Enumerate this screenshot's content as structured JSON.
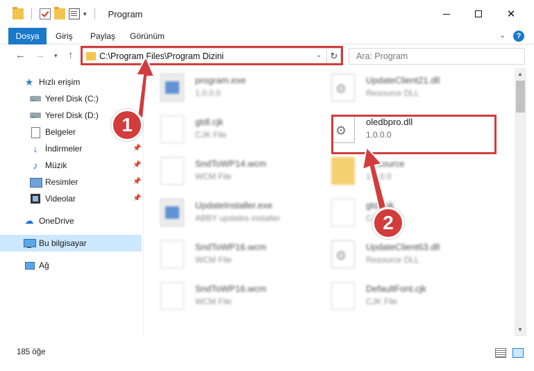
{
  "window": {
    "title": "Program",
    "minimize": "",
    "maximize": "",
    "close": "✕"
  },
  "ribbon": {
    "tabs": [
      "Dosya",
      "Giriş",
      "Paylaş",
      "Görünüm"
    ],
    "help": "?"
  },
  "nav": {
    "back": "←",
    "forward": "→",
    "recent": "▾",
    "up": "↑"
  },
  "address": {
    "path": "C:\\Program Files\\Program Dizini",
    "refresh": "↻"
  },
  "search": {
    "placeholder": "Ara: Program"
  },
  "sidebar": {
    "items": [
      {
        "label": "Hızlı erişim",
        "icon": "star-icon"
      },
      {
        "label": "Yerel Disk (C:)",
        "icon": "disk-icon"
      },
      {
        "label": "Yerel Disk (D:)",
        "icon": "disk-icon"
      },
      {
        "label": "Belgeler",
        "icon": "documents-icon"
      },
      {
        "label": "İndirmeler",
        "icon": "downloads-icon"
      },
      {
        "label": "Müzik",
        "icon": "music-icon"
      },
      {
        "label": "Resimler",
        "icon": "pictures-icon"
      },
      {
        "label": "Videolar",
        "icon": "videos-icon"
      },
      {
        "label": "OneDrive",
        "icon": "cloud-icon"
      },
      {
        "label": "Bu bilgisayar",
        "icon": "computer-icon"
      },
      {
        "label": "Ağ",
        "icon": "network-icon"
      }
    ]
  },
  "files": [
    {
      "name": "program.exe",
      "meta": "1.0.0.0",
      "icon": "exe-icon"
    },
    {
      "name": "UpdateClient21.dll",
      "meta": "Resource DLL",
      "icon": "dll-icon"
    },
    {
      "name": "gtdl.cjk",
      "meta": "CJK File",
      "icon": "file-icon"
    },
    {
      "name": "oledbpro.dll",
      "meta": "1.0.0.0",
      "icon": "dll-icon"
    },
    {
      "name": "SndToWP14.wcm",
      "meta": "WCM File",
      "icon": "file-icon"
    },
    {
      "name": "Resource",
      "meta": "1.0.0.0",
      "icon": "folder-icon"
    },
    {
      "name": "UpdateInstaller.exe",
      "meta": "ABBY updates installer",
      "icon": "exe-icon"
    },
    {
      "name": "gtdl.cjk",
      "meta": "CJK File",
      "icon": "file-icon"
    },
    {
      "name": "SndToWP16.wcm",
      "meta": "WCM File",
      "icon": "file-icon"
    },
    {
      "name": "UpdateClient63.dll",
      "meta": "Resource DLL",
      "icon": "dll-icon"
    },
    {
      "name": "SndToWP16.wcm",
      "meta": "WCM File",
      "icon": "file-icon"
    },
    {
      "name": "DefaultFont.cjk",
      "meta": "CJK File",
      "icon": "file-icon"
    }
  ],
  "callouts": {
    "step1": "1",
    "step2": "2"
  },
  "status": {
    "count": "185 öğe"
  },
  "colors": {
    "accent": "#1979ca",
    "highlight": "#d23c3c",
    "selection": "#cce8ff"
  }
}
